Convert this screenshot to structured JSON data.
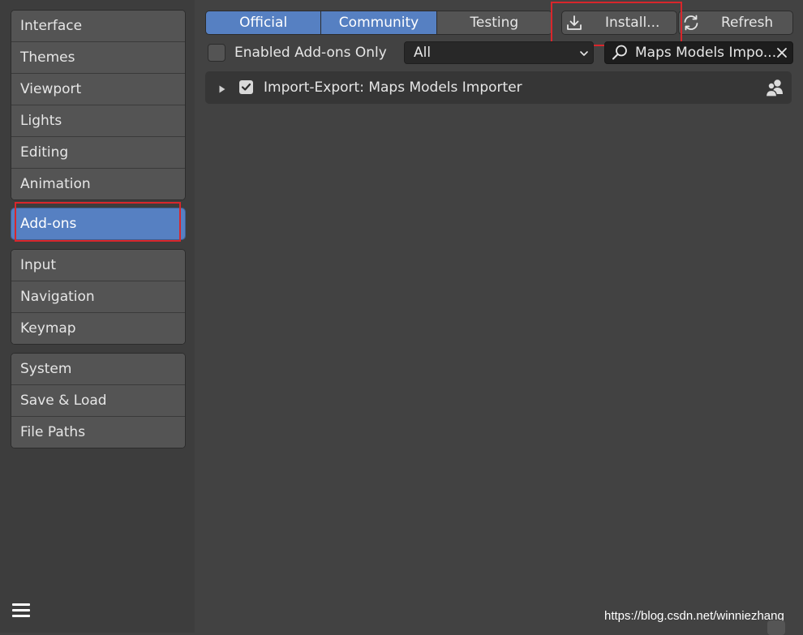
{
  "sidebar": {
    "group1": [
      "Interface",
      "Themes",
      "Viewport",
      "Lights",
      "Editing",
      "Animation"
    ],
    "group2": [
      "Add-ons"
    ],
    "group3": [
      "Input",
      "Navigation",
      "Keymap"
    ],
    "group4": [
      "System",
      "Save & Load",
      "File Paths"
    ],
    "active": "Add-ons"
  },
  "tabs": [
    {
      "label": "Official",
      "selected": true
    },
    {
      "label": "Community",
      "selected": true
    },
    {
      "label": "Testing",
      "selected": false
    }
  ],
  "toolbar": {
    "install_label": "Install...",
    "refresh_label": "Refresh",
    "install_icon": "download-icon",
    "refresh_icon": "refresh-icon"
  },
  "filter": {
    "enabled_only_label": "Enabled Add-ons Only",
    "enabled_only_checked": false,
    "category_value": "All",
    "search_value": "Maps Models Impo..."
  },
  "addons": [
    {
      "name": "Import-Export: Maps Models Importer",
      "enabled": true,
      "expanded": false,
      "support_icon": "community-icon"
    }
  ],
  "watermark": "https://blog.csdn.net/winniezhang",
  "colors": {
    "accent": "#5680c2",
    "highlight": "#d9262b",
    "background": "#424242",
    "sidebar_bg": "#3d3d3d"
  }
}
